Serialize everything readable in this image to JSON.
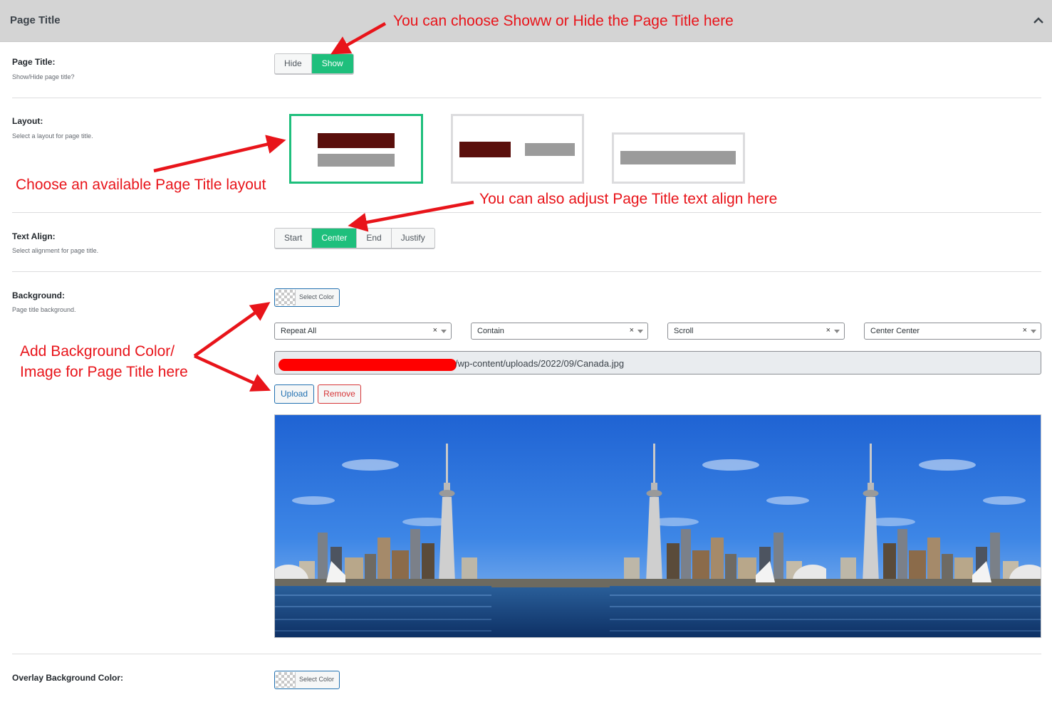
{
  "header": {
    "title": "Page Title"
  },
  "rows": {
    "page_title": {
      "label": "Page Title:",
      "desc": "Show/Hide page title?",
      "options": [
        "Hide",
        "Show"
      ],
      "selected": "Show"
    },
    "layout": {
      "label": "Layout:",
      "desc": "Select a layout for page title.",
      "selected_index": 0
    },
    "text_align": {
      "label": "Text Align:",
      "desc": "Select alignment for page title.",
      "options": [
        "Start",
        "Center",
        "End",
        "Justify"
      ],
      "selected": "Center"
    },
    "background": {
      "label": "Background:",
      "desc": "Page title background.",
      "color_button": "Select Color",
      "selects": [
        {
          "value": "Repeat All",
          "clear": "×"
        },
        {
          "value": "Contain",
          "clear": "×"
        },
        {
          "value": "Scroll",
          "clear": "×"
        },
        {
          "value": "Center Center",
          "clear": "×"
        }
      ],
      "image_url": "/wp-content/uploads/2022/09/Canada.jpg",
      "upload_label": "Upload",
      "remove_label": "Remove"
    },
    "overlay": {
      "label": "Overlay Background Color:",
      "color_button": "Select Color"
    }
  },
  "annotations": {
    "show_hide": "You can choose Showw or Hide the Page Title here",
    "layout": "Choose an available Page Title layout",
    "align": "You can also adjust Page Title text align here",
    "background_line1": "Add Background Color/",
    "background_line2": "Image for Page Title here"
  },
  "colors": {
    "accent": "#1ebf7c",
    "annotation": "#e8141a",
    "layout_dark_bar": "#5a0f0c",
    "layout_grey_bar": "#9b9b9b"
  }
}
